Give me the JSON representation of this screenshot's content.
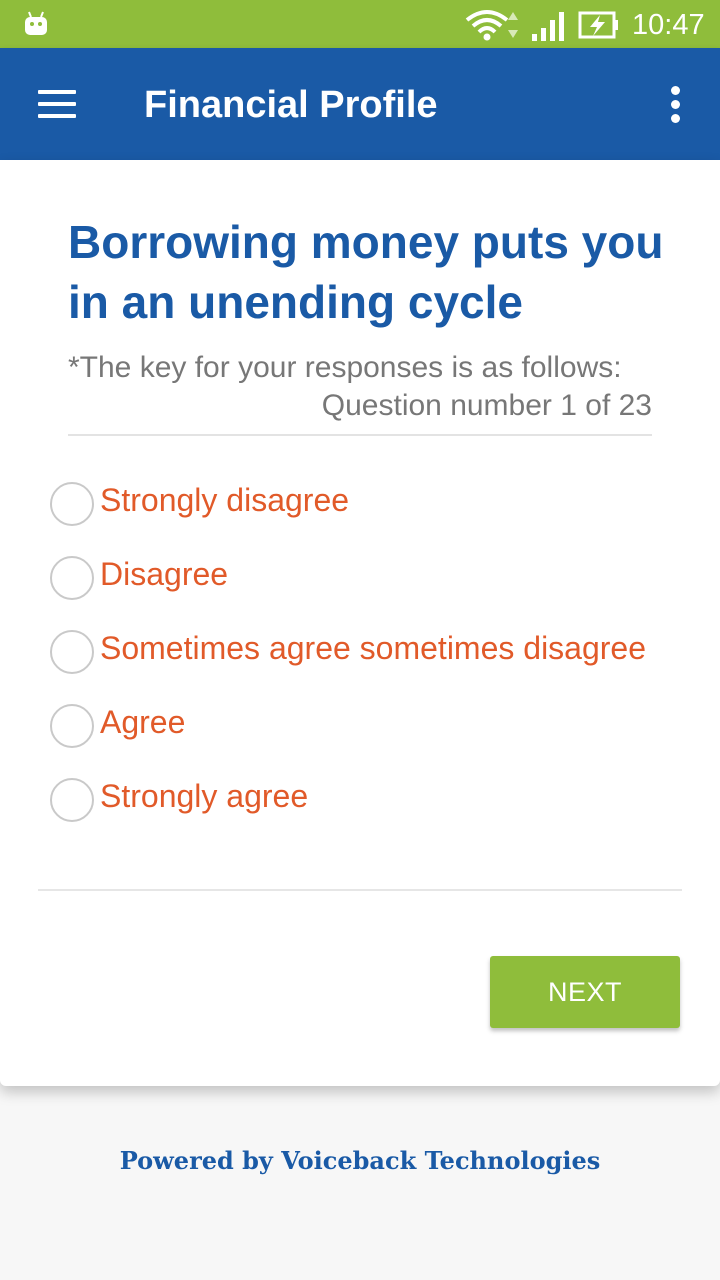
{
  "status_bar": {
    "time": "10:47",
    "background_color": "#8fbd3b",
    "icons": [
      "android-icon",
      "wifi-icon",
      "data-arrows-icon",
      "signal-icon",
      "battery-charging-icon"
    ]
  },
  "app_bar": {
    "title": "Financial Profile",
    "background_color": "#1a5aa6",
    "menu_icon": "hamburger-menu-icon",
    "overflow_icon": "overflow-menu-icon"
  },
  "question": {
    "title": "Borrowing money puts you in an unending cycle",
    "key_text": "*The key for your responses is as follows:",
    "counter": "Question number 1 of 23",
    "options": [
      {
        "label": "Strongly disagree",
        "selected": false
      },
      {
        "label": "Disagree",
        "selected": false
      },
      {
        "label": "Sometimes agree sometimes disagree",
        "selected": false
      },
      {
        "label": "Agree",
        "selected": false
      },
      {
        "label": "Strongly agree",
        "selected": false
      }
    ],
    "title_color": "#1a5aa6",
    "option_color": "#e15a29"
  },
  "actions": {
    "next_label": "NEXT",
    "next_color": "#8fbd3b"
  },
  "footer": {
    "powered_by": "Powered by Voiceback Technologies"
  }
}
